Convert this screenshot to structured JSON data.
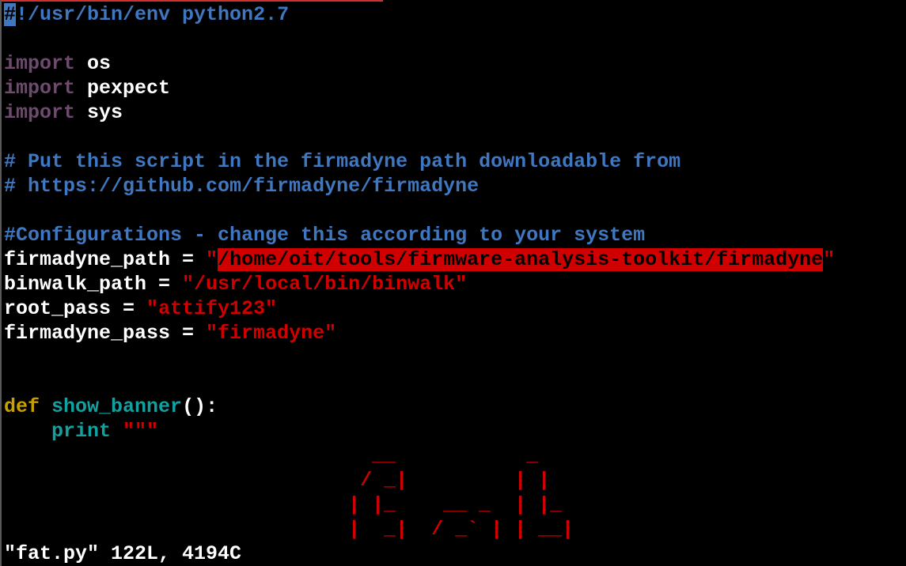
{
  "editor": {
    "shebang_cursor_char": "#",
    "shebang_rest": "!/usr/bin/env python2.7",
    "imports": [
      {
        "keyword": "import",
        "module": "os"
      },
      {
        "keyword": "import",
        "module": "pexpect"
      },
      {
        "keyword": "import",
        "module": "sys"
      }
    ],
    "comment1": "# Put this script in the firmadyne path downloadable from",
    "comment2": "# https://github.com/firmadyne/firmadyne",
    "comment3": "#Configurations - change this according to your system",
    "assignments": [
      {
        "name": "firmadyne_path = ",
        "q1": "\"",
        "value": "/home/oit/tools/firmware-analysis-toolkit/firmadyne",
        "q2": "\""
      },
      {
        "name": "binwalk_path = ",
        "value": "\"/usr/local/bin/binwalk\""
      },
      {
        "name": "root_pass = ",
        "value": "\"attify123\""
      },
      {
        "name": "firmadyne_pass = ",
        "value": "\"firmadyne\""
      }
    ],
    "def_keyword": "def",
    "func_name": "show_banner",
    "func_sig": "():",
    "print_indent": "    ",
    "print_keyword": "print",
    "print_string": " \"\"\"",
    "ascii_art": [
      "                               __           _",
      "                              / _|         | |",
      "                             | |_    __ _  | |_",
      "                             |  _|  / _` | | __|"
    ]
  },
  "status_line": "\"fat.py\" 122L, 4194C",
  "colors": {
    "comment": "#3f78c0",
    "keyword": "#6e4a6e",
    "def": "#c8a000",
    "function": "#12a0a0",
    "string": "#d00000",
    "search_highlight": "#d00000",
    "cursor": "#3f78c0"
  }
}
